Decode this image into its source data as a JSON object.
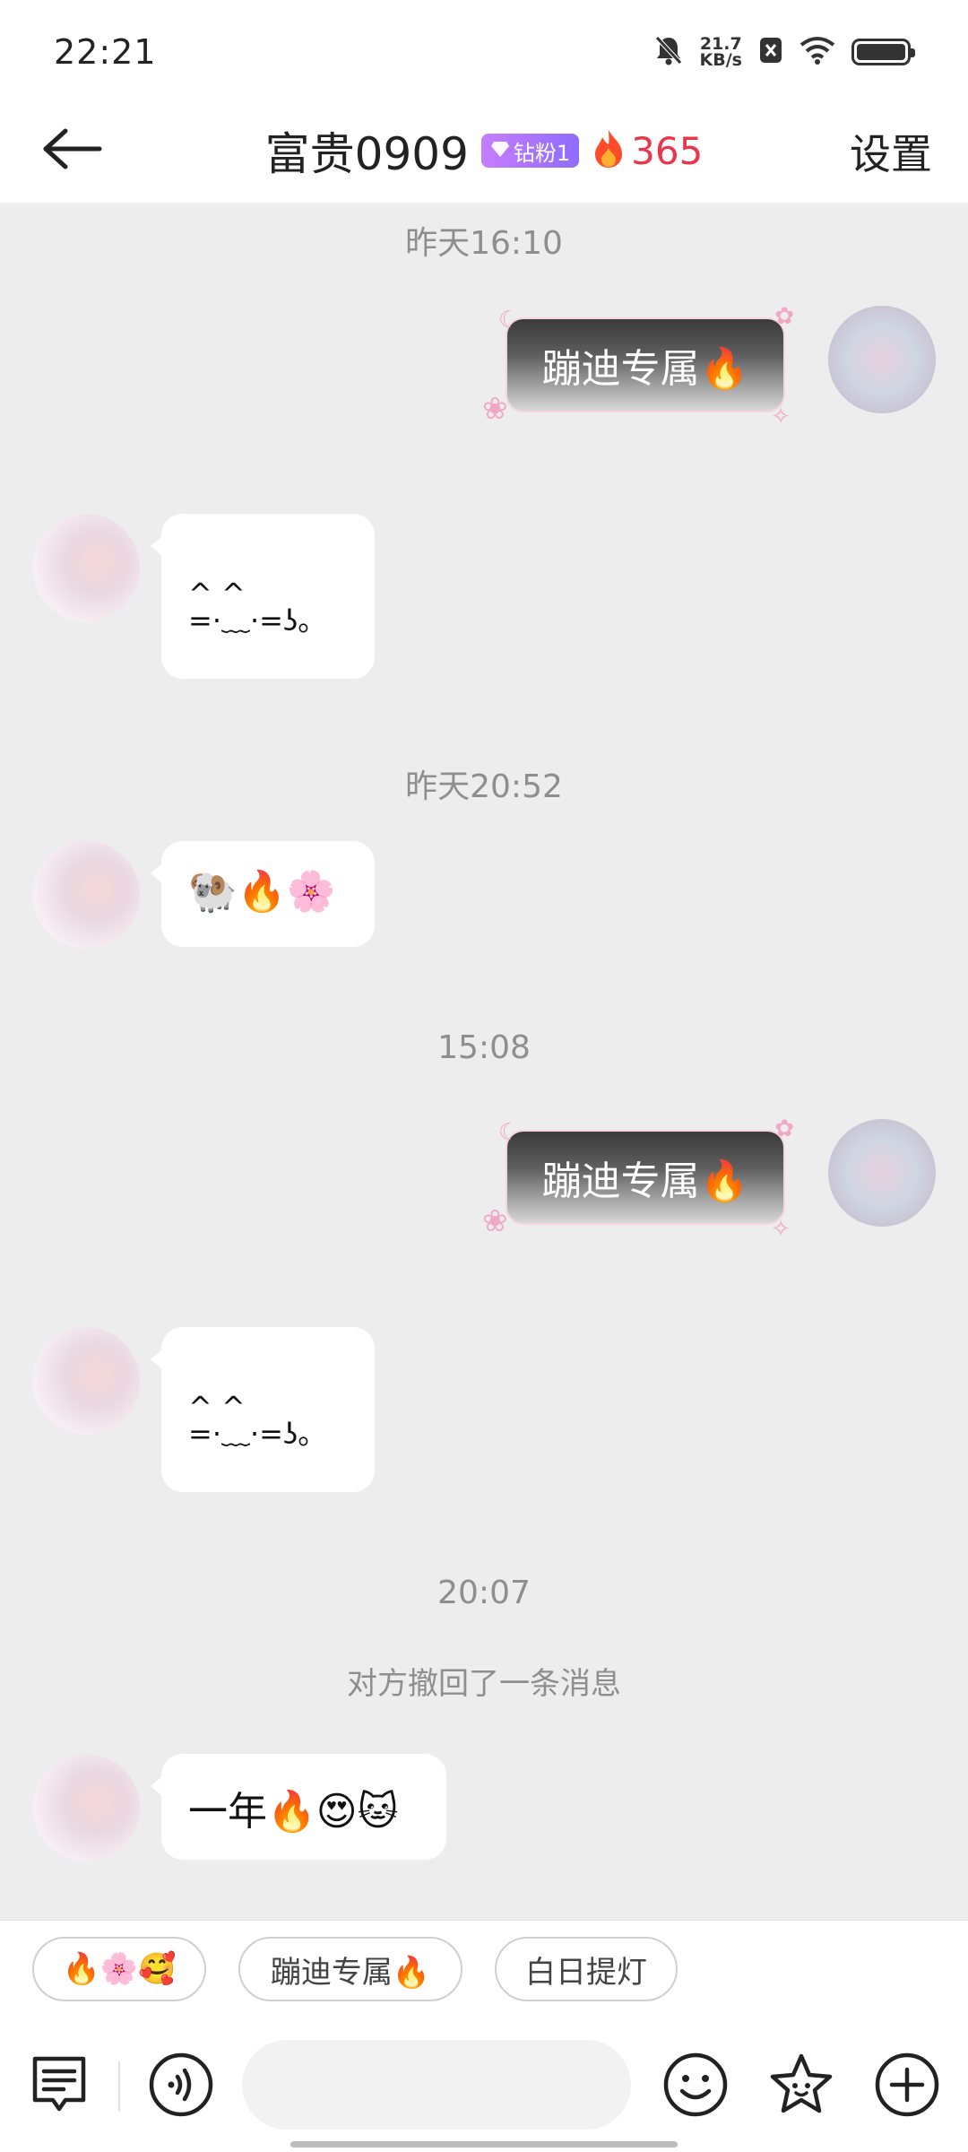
{
  "status_bar": {
    "time": "22:21",
    "net_speed_value": "21.7",
    "net_speed_unit": "KB/s",
    "icons": [
      "mute-bell-icon",
      "close-box-icon",
      "wifi-icon",
      "battery-icon"
    ]
  },
  "header": {
    "back_icon": "back-arrow-icon",
    "title": "富贵0909",
    "fan_badge": "钻粉1",
    "fire_count": "365",
    "settings_label": "设置"
  },
  "messages": {
    "ts1": "昨天16:10",
    "m1": "蹦迪专属🔥",
    "m2_line1": "^   ^",
    "m2_line2": "=·﹏·=ʖ。",
    "ts2": "昨天20:52",
    "m3": "🐏🔥🌸",
    "ts3": "15:08",
    "m4": "蹦迪专属🔥",
    "m5_line1": "^   ^",
    "m5_line2": "=·﹏·=ʖ。",
    "ts4": "20:07",
    "system_note": "对方撤回了一条消息",
    "m6": "一年🔥😍🐱"
  },
  "quick_replies": {
    "chip1": "🔥🌸🥰",
    "chip2": "蹦迪专属🔥",
    "chip3": "白日提灯"
  },
  "input_bar": {
    "placeholder": "",
    "icons": [
      "chat-menu-icon",
      "voice-icon",
      "emoji-face-icon",
      "star-sticker-icon",
      "plus-icon"
    ]
  },
  "colors": {
    "accent_red": "#e8364b",
    "badge_purple": "#a77dff",
    "chat_bg": "#ededed"
  }
}
